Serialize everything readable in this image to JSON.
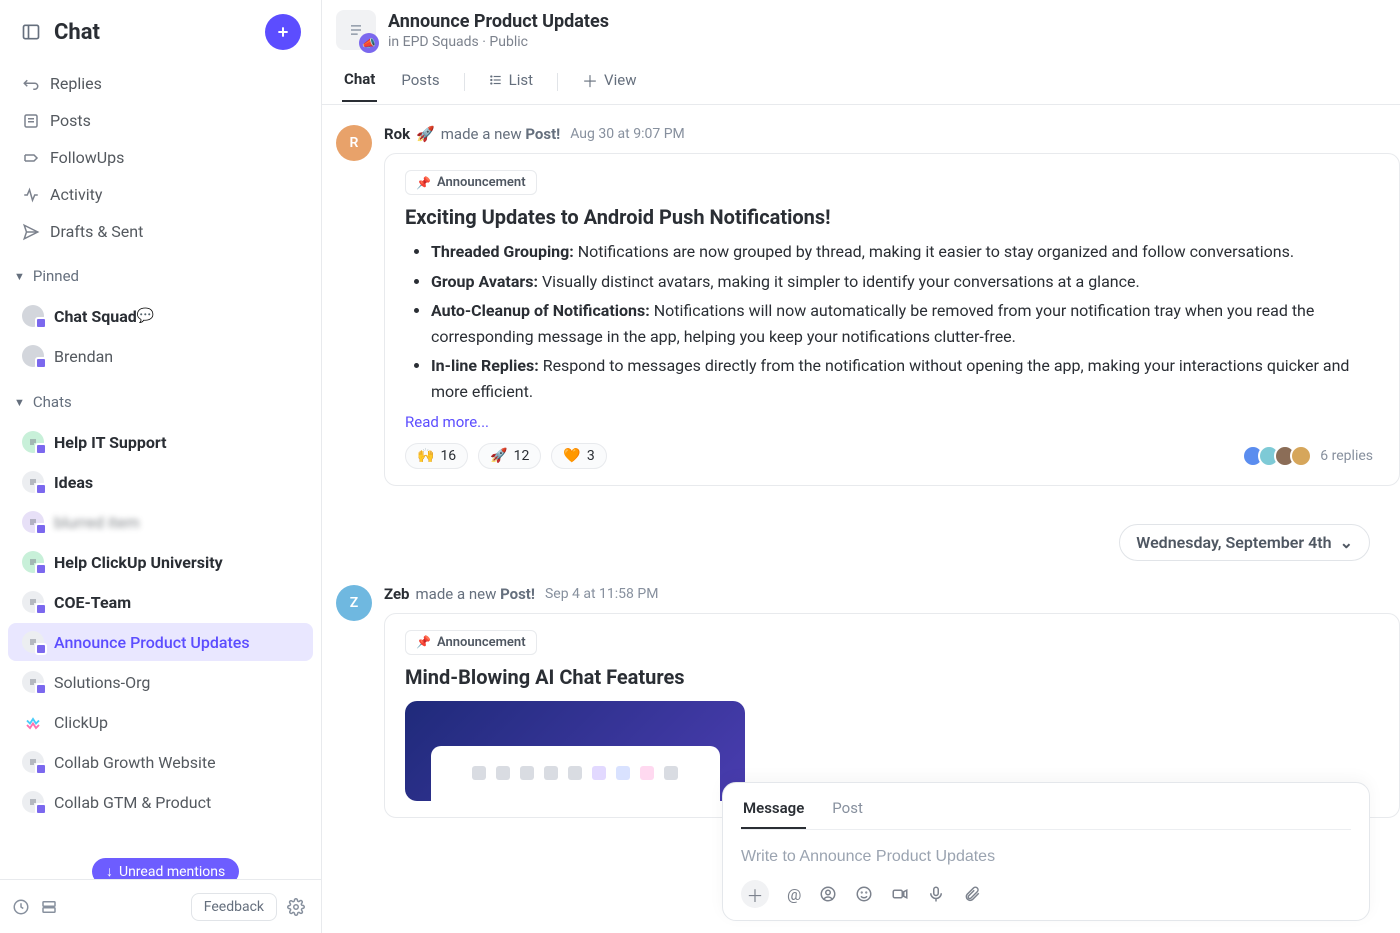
{
  "sidebar": {
    "title": "Chat",
    "nav": [
      {
        "label": "Replies",
        "icon": "reply"
      },
      {
        "label": "Posts",
        "icon": "post"
      },
      {
        "label": "FollowUps",
        "icon": "followup"
      },
      {
        "label": "Activity",
        "icon": "activity"
      },
      {
        "label": "Drafts & Sent",
        "icon": "send"
      }
    ],
    "pinned_label": "Pinned",
    "pinned": [
      {
        "label": "Chat Squad",
        "bold": true,
        "speech": true
      },
      {
        "label": "Brendan"
      }
    ],
    "chats_label": "Chats",
    "chats": [
      {
        "label": "Help IT Support",
        "bold": true,
        "avatar": "green"
      },
      {
        "label": "Ideas",
        "bold": true,
        "avatar": "grey"
      },
      {
        "label": "blurred item",
        "blur": true,
        "avatar": "purple"
      },
      {
        "label": "Help ClickUp University",
        "bold": true,
        "avatar": "green"
      },
      {
        "label": "COE-Team",
        "bold": true,
        "avatar": "grey"
      },
      {
        "label": "Announce Product Updates",
        "active": true,
        "avatar": "grey"
      },
      {
        "label": "Solutions-Org",
        "avatar": "grey"
      },
      {
        "label": "ClickUp",
        "clickup": true
      },
      {
        "label": "Collab Growth Website",
        "avatar": "grey"
      },
      {
        "label": "Collab GTM & Product",
        "avatar": "grey"
      }
    ],
    "add_chat": "Add Chat",
    "unread_pill": "Unread mentions",
    "feedback": "Feedback"
  },
  "header": {
    "title": "Announce Product Updates",
    "breadcrumb_prefix": "in ",
    "breadcrumb_space": "EPD Squads",
    "breadcrumb_sep": " · ",
    "breadcrumb_vis": "Public",
    "tabs": [
      {
        "label": "Chat",
        "active": true
      },
      {
        "label": "Posts"
      },
      {
        "label": "List",
        "icon": "list"
      },
      {
        "label": "View",
        "icon": "plus"
      }
    ]
  },
  "feed": {
    "post1": {
      "author": "Rok",
      "emoji": "🚀",
      "action_pre": "made a new ",
      "action_bold": "Post!",
      "ts": "Aug 30 at 9:07 PM",
      "tag": "Announcement",
      "title": "Exciting Updates to Android Push Notifications!",
      "bullets": [
        {
          "b": "Threaded Grouping:",
          "t": " Notifications are now grouped by thread, making it easier to stay organized and follow conversations."
        },
        {
          "b": "Group Avatars:",
          "t": " Visually distinct avatars, making it simpler to identify your conversations at a glance."
        },
        {
          "b": "Auto-Cleanup of Notifications:",
          "t": " Notifications will now automatically be removed from your notification tray when you read the corresponding message in the app, helping you keep your notifications clutter-free."
        },
        {
          "b": "In-line Replies:",
          "t": " Respond to messages directly from the notification without opening the app, making your interactions quicker and more efficient."
        }
      ],
      "readmore": "Read more...",
      "reactions": [
        {
          "emoji": "🙌",
          "count": "16"
        },
        {
          "emoji": "🚀",
          "count": "12"
        },
        {
          "emoji": "🧡",
          "count": "3"
        }
      ],
      "replies": "6 replies"
    },
    "date_divider": "Wednesday, September 4th",
    "post2": {
      "author": "Zeb",
      "action_pre": "made a new ",
      "action_bold": "Post!",
      "ts": "Sep 4 at 11:58 PM",
      "tag": "Announcement",
      "title": "Mind-Blowing AI Chat Features"
    }
  },
  "composer": {
    "tabs": [
      {
        "label": "Message",
        "active": true
      },
      {
        "label": "Post"
      }
    ],
    "placeholder": "Write to Announce Product Updates"
  }
}
